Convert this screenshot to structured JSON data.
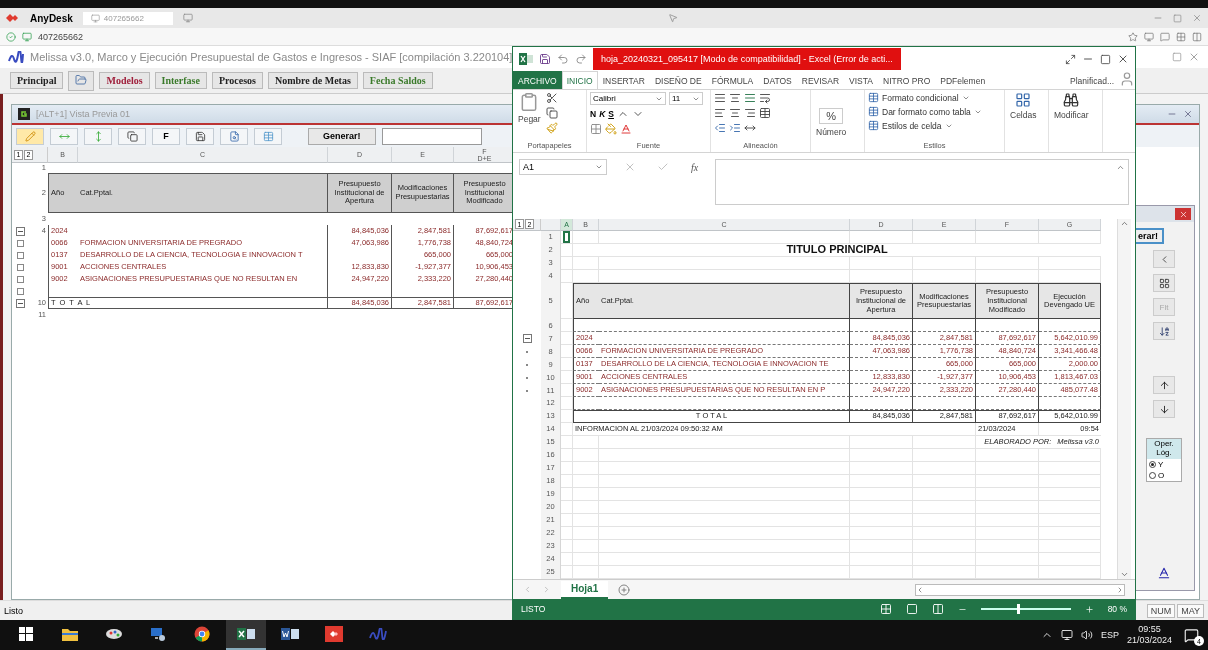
{
  "anydesk": {
    "app": "AnyDesk",
    "tab": "407265662",
    "address": "407265662"
  },
  "melissa": {
    "title": "Melissa v3.0, Marco y Ejecución Presupuestal de Gastos e Ingresos - SIAF  [compilación 3.220104]",
    "menu": [
      {
        "kind": "text",
        "label": "Principal",
        "color": "#222222"
      },
      {
        "kind": "icon"
      },
      {
        "kind": "text",
        "label": "Modelos",
        "color": "#a0203c"
      },
      {
        "kind": "text",
        "label": "Interfase",
        "color": "#3a7a2a"
      },
      {
        "kind": "text",
        "label": "Procesos",
        "color": "#222222"
      },
      {
        "kind": "text",
        "label": "Nombre de Metas",
        "color": "#222222"
      },
      {
        "kind": "text",
        "label": "Fecha Saldos",
        "color": "#3a7a2a"
      }
    ],
    "child": {
      "title": "[ALT+1] Vista Previa 01",
      "toolbar": {
        "text_button": "F",
        "generate": "Generar!"
      },
      "outline_levels": [
        "1",
        "2"
      ],
      "columns": [
        {
          "letter": "B"
        },
        {
          "letter": "C"
        },
        {
          "letter": "D"
        },
        {
          "letter": "E"
        },
        {
          "letter": "F",
          "formula": "D+E"
        }
      ],
      "rows": [
        {
          "num": "1",
          "kind": "blank",
          "collapsible": false,
          "grouped": false
        },
        {
          "num": "2",
          "kind": "header",
          "code": "Año",
          "name": "Cat.Pptal.",
          "d": "Presupuesto Institucional de Apertura",
          "e": "Modificaciones Presupuestarias",
          "f": "Presupuesto Institucional Modificado",
          "collapsible": false,
          "grouped": false
        },
        {
          "num": "3",
          "kind": "blank",
          "collapsible": false,
          "grouped": false
        },
        {
          "num": "4",
          "kind": "data",
          "code": "2024",
          "d": "84,845,036",
          "e": "2,847,581",
          "f": "87,692,617",
          "collapsible": true,
          "grouped": false
        },
        {
          "kind": "data",
          "code": "0066",
          "name": "FORMACION UNIVERSITARIA DE PREGRADO",
          "d": "47,063,986",
          "e": "1,776,738",
          "f": "48,840,724",
          "collapsible": false,
          "grouped": true
        },
        {
          "kind": "data",
          "code": "0137",
          "name": "DESARROLLO DE LA CIENCIA, TECNOLOGIA E INNOVACION T",
          "e": "665,000",
          "f": "665,000",
          "collapsible": false,
          "grouped": true
        },
        {
          "kind": "data",
          "code": "9001",
          "name": "ACCIONES CENTRALES",
          "d": "12,833,830",
          "e": "-1,927,377",
          "f": "10,906,453",
          "collapsible": false,
          "grouped": true
        },
        {
          "kind": "data",
          "code": "9002",
          "name": "ASIGNACIONES PRESUPUESTARIAS QUE NO RESULTAN EN",
          "d": "24,947,220",
          "e": "2,333,220",
          "f": "27,280,440",
          "collapsible": false,
          "grouped": true
        },
        {
          "kind": "blank",
          "collapsible": false,
          "grouped": true
        },
        {
          "num": "10",
          "kind": "total",
          "label": "T O T A L",
          "d": "84,845,036",
          "e": "2,847,581",
          "f": "87,692,617",
          "collapsible": true,
          "grouped": false
        },
        {
          "num": "11",
          "kind": "blank",
          "collapsible": false,
          "grouped": false
        }
      ]
    },
    "side_panel": {
      "generate_partial": "erar!",
      "filter": "Flt",
      "logic": {
        "title": "Oper. Lóg.",
        "options": [
          {
            "label": "Y",
            "selected": true
          },
          {
            "label": "O",
            "selected": false
          }
        ]
      }
    },
    "status": {
      "text": "Listo",
      "keys": [
        "NUM",
        "MAY"
      ]
    }
  },
  "excel": {
    "title": "hoja_20240321_095417  [Modo de compatibilidad] -  Excel (Error de acti...",
    "ribbon": {
      "tabs": [
        {
          "label": "ARCHIVO",
          "kind": "file",
          "selected": false
        },
        {
          "label": "INICIO",
          "kind": "tab",
          "selected": true
        },
        {
          "label": "INSERTAR",
          "kind": "tab",
          "selected": false
        },
        {
          "label": "DISEÑO DE",
          "kind": "tab",
          "selected": false
        },
        {
          "label": "FÓRMULA",
          "kind": "tab",
          "selected": false
        },
        {
          "label": "DATOS",
          "kind": "tab",
          "selected": false
        },
        {
          "label": "REVISAR",
          "kind": "tab",
          "selected": false
        },
        {
          "label": "VISTA",
          "kind": "tab",
          "selected": false
        },
        {
          "label": "NITRO PRO",
          "kind": "tab",
          "selected": false
        },
        {
          "label": "PDFelemen",
          "kind": "tab",
          "selected": false
        }
      ],
      "account": "Planificad...",
      "paste": "Pegar",
      "font": "Calibri",
      "size": "11",
      "bold": "N",
      "italic": "K",
      "underline": "S",
      "number": "Número",
      "percent": "%",
      "styles": [
        "Formato condicional",
        "Dar formato como tabla",
        "Estilos de celda"
      ],
      "cells": "Celdas",
      "edit": "Modificar",
      "groups": [
        "Portapapeles",
        "Fuente",
        "Alineación",
        "Estilos"
      ]
    },
    "formula_bar": {
      "name_box": "A1",
      "fx": "fx"
    },
    "outline_levels": [
      "1",
      "2"
    ],
    "columns": [
      {
        "letter": "A",
        "selected": true
      },
      {
        "letter": "B",
        "selected": false
      },
      {
        "letter": "C",
        "selected": false
      },
      {
        "letter": "D",
        "selected": false
      },
      {
        "letter": "E",
        "selected": false
      },
      {
        "letter": "F",
        "selected": false
      },
      {
        "letter": "G",
        "selected": false
      }
    ],
    "rows": [
      {
        "num": "1",
        "kind": "blank",
        "selected": true,
        "collapsible": false,
        "grouped": false
      },
      {
        "num": "2",
        "kind": "title",
        "text": "TITULO PRINCIPAL",
        "selected": false,
        "collapsible": false,
        "grouped": false
      },
      {
        "num": "3",
        "kind": "blank",
        "selected": false,
        "collapsible": false,
        "grouped": false
      },
      {
        "num": "4",
        "kind": "blank",
        "selected": false,
        "collapsible": false,
        "grouped": false
      },
      {
        "num": "5",
        "kind": "header",
        "code": "Año",
        "name": "Cat.Pptal.",
        "d": "Presupuesto Institucional de Apertura",
        "e": "Modificaciones Presupuestarias",
        "f": "Presupuesto Institucional Modificado",
        "g": "Ejecución Devengado UE",
        "selected": false,
        "collapsible": false,
        "grouped": false
      },
      {
        "num": "6",
        "kind": "tblank",
        "selected": false,
        "collapsible": false,
        "grouped": false
      },
      {
        "num": "7",
        "kind": "data",
        "code": "2024",
        "d": "84,845,036",
        "e": "2,847,581",
        "f": "87,692,617",
        "g": "5,642,010.99",
        "selected": false,
        "collapsible": true,
        "grouped": false
      },
      {
        "num": "8",
        "kind": "data",
        "code": "0066",
        "name": "FORMACION UNIVERSITARIA DE PREGRADO",
        "d": "47,063,986",
        "e": "1,776,738",
        "f": "48,840,724",
        "g": "3,341,466.48",
        "selected": false,
        "collapsible": false,
        "grouped": true
      },
      {
        "num": "9",
        "kind": "data",
        "code": "0137",
        "name": "DESARROLLO DE LA CIENCIA, TECNOLOGIA E INNOVACION TE",
        "e": "665,000",
        "f": "665,000",
        "g": "2,000.00",
        "selected": false,
        "collapsible": false,
        "grouped": true
      },
      {
        "num": "10",
        "kind": "data",
        "code": "9001",
        "name": "ACCIONES CENTRALES",
        "d": "12,833,830",
        "e": "-1,927,377",
        "f": "10,906,453",
        "g": "1,813,467.03",
        "selected": false,
        "collapsible": false,
        "grouped": true
      },
      {
        "num": "11",
        "kind": "data",
        "code": "9002",
        "name": "ASIGNACIONES PRESUPUESTARIAS QUE NO RESULTAN EN P",
        "d": "24,947,220",
        "e": "2,333,220",
        "f": "27,280,440",
        "g": "485,077.48",
        "selected": false,
        "collapsible": false,
        "grouped": true
      },
      {
        "num": "12",
        "kind": "tblank",
        "selected": false,
        "collapsible": false,
        "grouped": false
      },
      {
        "num": "13",
        "kind": "total",
        "label": "T O T A L",
        "d": "84,845,036",
        "e": "2,847,581",
        "f": "87,692,617",
        "g": "5,642,010.99",
        "selected": false,
        "collapsible": false,
        "grouped": false
      },
      {
        "num": "14",
        "kind": "info",
        "text": "INFORMACION AL 21/03/2024 09:50:32 AM",
        "f": "21/03/2024",
        "g": "09:54",
        "selected": false,
        "collapsible": false,
        "grouped": false
      },
      {
        "num": "15",
        "kind": "credit",
        "label": "ELABORADO POR:",
        "value": "Melissa v3.0",
        "selected": false,
        "collapsible": false,
        "grouped": false
      },
      {
        "num": "16",
        "kind": "blank",
        "selected": false,
        "collapsible": false,
        "grouped": false
      },
      {
        "num": "17",
        "kind": "blank",
        "selected": false,
        "collapsible": false,
        "grouped": false
      },
      {
        "num": "18",
        "kind": "blank",
        "selected": false,
        "collapsible": false,
        "grouped": false
      },
      {
        "num": "19",
        "kind": "blank",
        "selected": false,
        "collapsible": false,
        "grouped": false
      },
      {
        "num": "20",
        "kind": "blank",
        "selected": false,
        "collapsible": false,
        "grouped": false
      },
      {
        "num": "21",
        "kind": "blank",
        "selected": false,
        "collapsible": false,
        "grouped": false
      },
      {
        "num": "22",
        "kind": "blank",
        "selected": false,
        "collapsible": false,
        "grouped": false
      },
      {
        "num": "23",
        "kind": "blank",
        "selected": false,
        "collapsible": false,
        "grouped": false
      },
      {
        "num": "24",
        "kind": "blank",
        "selected": false,
        "collapsible": false,
        "grouped": false
      },
      {
        "num": "25",
        "kind": "blank",
        "selected": false,
        "collapsible": false,
        "grouped": false
      }
    ],
    "sheets": [
      {
        "label": "Hoja1",
        "selected": true
      }
    ],
    "status": {
      "text": "LISTO",
      "zoom": "80 %",
      "level": 0.4
    }
  },
  "taskbar": {
    "apps": [
      {
        "kind": "windows",
        "selected": false
      },
      {
        "kind": "explorer",
        "selected": false
      },
      {
        "kind": "paint",
        "selected": false
      },
      {
        "kind": "network",
        "selected": false
      },
      {
        "kind": "chrome",
        "selected": false
      },
      {
        "kind": "excel",
        "selected": true
      },
      {
        "kind": "word",
        "selected": false
      },
      {
        "kind": "anydesk",
        "selected": false
      },
      {
        "kind": "melissa",
        "selected": false
      }
    ],
    "tray": {
      "lang": "ESP",
      "time": "09:55",
      "date": "21/03/2024",
      "notifications": "4"
    }
  }
}
